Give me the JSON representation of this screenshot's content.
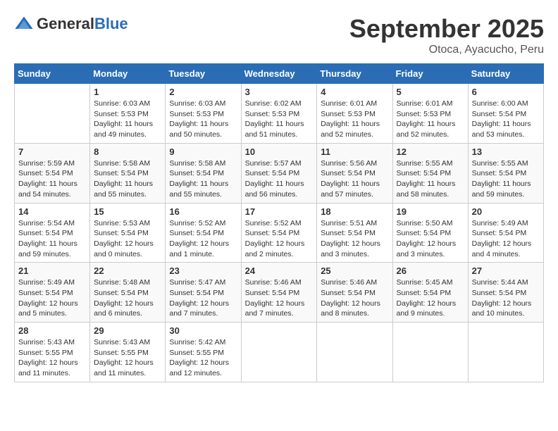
{
  "header": {
    "logo_general": "General",
    "logo_blue": "Blue",
    "month": "September 2025",
    "location": "Otoca, Ayacucho, Peru"
  },
  "calendar": {
    "days_of_week": [
      "Sunday",
      "Monday",
      "Tuesday",
      "Wednesday",
      "Thursday",
      "Friday",
      "Saturday"
    ],
    "weeks": [
      [
        {
          "day": "",
          "info": ""
        },
        {
          "day": "1",
          "info": "Sunrise: 6:03 AM\nSunset: 5:53 PM\nDaylight: 11 hours\nand 49 minutes."
        },
        {
          "day": "2",
          "info": "Sunrise: 6:03 AM\nSunset: 5:53 PM\nDaylight: 11 hours\nand 50 minutes."
        },
        {
          "day": "3",
          "info": "Sunrise: 6:02 AM\nSunset: 5:53 PM\nDaylight: 11 hours\nand 51 minutes."
        },
        {
          "day": "4",
          "info": "Sunrise: 6:01 AM\nSunset: 5:53 PM\nDaylight: 11 hours\nand 52 minutes."
        },
        {
          "day": "5",
          "info": "Sunrise: 6:01 AM\nSunset: 5:53 PM\nDaylight: 11 hours\nand 52 minutes."
        },
        {
          "day": "6",
          "info": "Sunrise: 6:00 AM\nSunset: 5:54 PM\nDaylight: 11 hours\nand 53 minutes."
        }
      ],
      [
        {
          "day": "7",
          "info": "Sunrise: 5:59 AM\nSunset: 5:54 PM\nDaylight: 11 hours\nand 54 minutes."
        },
        {
          "day": "8",
          "info": "Sunrise: 5:58 AM\nSunset: 5:54 PM\nDaylight: 11 hours\nand 55 minutes."
        },
        {
          "day": "9",
          "info": "Sunrise: 5:58 AM\nSunset: 5:54 PM\nDaylight: 11 hours\nand 55 minutes."
        },
        {
          "day": "10",
          "info": "Sunrise: 5:57 AM\nSunset: 5:54 PM\nDaylight: 11 hours\nand 56 minutes."
        },
        {
          "day": "11",
          "info": "Sunrise: 5:56 AM\nSunset: 5:54 PM\nDaylight: 11 hours\nand 57 minutes."
        },
        {
          "day": "12",
          "info": "Sunrise: 5:55 AM\nSunset: 5:54 PM\nDaylight: 11 hours\nand 58 minutes."
        },
        {
          "day": "13",
          "info": "Sunrise: 5:55 AM\nSunset: 5:54 PM\nDaylight: 11 hours\nand 59 minutes."
        }
      ],
      [
        {
          "day": "14",
          "info": "Sunrise: 5:54 AM\nSunset: 5:54 PM\nDaylight: 11 hours\nand 59 minutes."
        },
        {
          "day": "15",
          "info": "Sunrise: 5:53 AM\nSunset: 5:54 PM\nDaylight: 12 hours\nand 0 minutes."
        },
        {
          "day": "16",
          "info": "Sunrise: 5:52 AM\nSunset: 5:54 PM\nDaylight: 12 hours\nand 1 minute."
        },
        {
          "day": "17",
          "info": "Sunrise: 5:52 AM\nSunset: 5:54 PM\nDaylight: 12 hours\nand 2 minutes."
        },
        {
          "day": "18",
          "info": "Sunrise: 5:51 AM\nSunset: 5:54 PM\nDaylight: 12 hours\nand 3 minutes."
        },
        {
          "day": "19",
          "info": "Sunrise: 5:50 AM\nSunset: 5:54 PM\nDaylight: 12 hours\nand 3 minutes."
        },
        {
          "day": "20",
          "info": "Sunrise: 5:49 AM\nSunset: 5:54 PM\nDaylight: 12 hours\nand 4 minutes."
        }
      ],
      [
        {
          "day": "21",
          "info": "Sunrise: 5:49 AM\nSunset: 5:54 PM\nDaylight: 12 hours\nand 5 minutes."
        },
        {
          "day": "22",
          "info": "Sunrise: 5:48 AM\nSunset: 5:54 PM\nDaylight: 12 hours\nand 6 minutes."
        },
        {
          "day": "23",
          "info": "Sunrise: 5:47 AM\nSunset: 5:54 PM\nDaylight: 12 hours\nand 7 minutes."
        },
        {
          "day": "24",
          "info": "Sunrise: 5:46 AM\nSunset: 5:54 PM\nDaylight: 12 hours\nand 7 minutes."
        },
        {
          "day": "25",
          "info": "Sunrise: 5:46 AM\nSunset: 5:54 PM\nDaylight: 12 hours\nand 8 minutes."
        },
        {
          "day": "26",
          "info": "Sunrise: 5:45 AM\nSunset: 5:54 PM\nDaylight: 12 hours\nand 9 minutes."
        },
        {
          "day": "27",
          "info": "Sunrise: 5:44 AM\nSunset: 5:54 PM\nDaylight: 12 hours\nand 10 minutes."
        }
      ],
      [
        {
          "day": "28",
          "info": "Sunrise: 5:43 AM\nSunset: 5:55 PM\nDaylight: 12 hours\nand 11 minutes."
        },
        {
          "day": "29",
          "info": "Sunrise: 5:43 AM\nSunset: 5:55 PM\nDaylight: 12 hours\nand 11 minutes."
        },
        {
          "day": "30",
          "info": "Sunrise: 5:42 AM\nSunset: 5:55 PM\nDaylight: 12 hours\nand 12 minutes."
        },
        {
          "day": "",
          "info": ""
        },
        {
          "day": "",
          "info": ""
        },
        {
          "day": "",
          "info": ""
        },
        {
          "day": "",
          "info": ""
        }
      ]
    ]
  }
}
